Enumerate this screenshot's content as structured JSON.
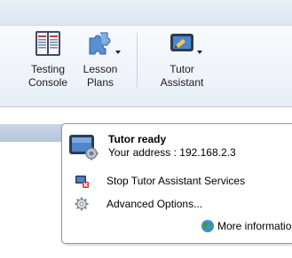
{
  "ribbon": {
    "testing_console": {
      "line1": "Testing",
      "line2": "Console"
    },
    "lesson_plans": {
      "line1": "Lesson",
      "line2": "Plans"
    },
    "tutor_assistant": {
      "line1": "Tutor",
      "line2": "Assistant"
    }
  },
  "popup": {
    "title": "Tutor ready",
    "address": "Your address : 192.168.2.3",
    "items": [
      {
        "label": "Stop Tutor Assistant Services",
        "icon": "stop-services-icon"
      },
      {
        "label": "Advanced Options...",
        "icon": "gear-icon"
      }
    ],
    "more_label": "More information",
    "more_icon": "globe-icon"
  },
  "colors": {
    "ribbon_bg": "#eef3fa",
    "accent_blue": "#2f6fb8",
    "globe_green": "#3aa23a"
  }
}
